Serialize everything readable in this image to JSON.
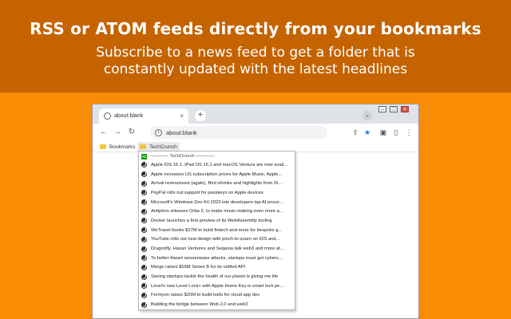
{
  "banner": {
    "title": "RSS or ATOM feeds directly from your bookmarks",
    "subtitle_line1": "Subscribe to a news feed to get a folder that is",
    "subtitle_line2": "constantly updated with the latest headlines"
  },
  "browser": {
    "tab_title": "about:blank",
    "tab_close": "×",
    "new_tab": "+",
    "tab_search": "⌄",
    "window_controls": {
      "minimize": "–",
      "maximize": "□",
      "close": "×"
    },
    "nav": {
      "back": "←",
      "forward": "→",
      "reload": "↻"
    },
    "address": "about:blank",
    "address_info": "i",
    "toolbar_icons": {
      "share": "⇪",
      "star": "★",
      "reading": "▣",
      "profile": "▯",
      "menu": "⋮"
    },
    "bookmarks_bar": [
      {
        "label": "Bookmarks"
      },
      {
        "label": "TechCrunch"
      }
    ]
  },
  "feed_menu": {
    "favicon_text": "TC",
    "header": "———— TechCrunch ————",
    "items": [
      "Apple iOS 16.1, iPad OS 16.1 and macOS Ventura are now avail...",
      "Apple increases US subscription prices for Apple Music, Apple...",
      "Arrival restructures (again), Bird shrinks and highlights from Di...",
      "PayPal rolls out support for passkeys on Apple devices",
      "Microsoft's Windows Dev Kit 2023 lets developers tap AI proce...",
      "Antiphon releases Orba 2, to make music-making even more a...",
      "Docker launches a first preview of its WebAssembly tooling",
      "WeTravel books $27M to build fintech and more for bespoke g...",
      "YouTube rolls out new design with pinch-to-zoom on iOS and...",
      "Dragonfly, Hasun Ventures and Sequoia talk web3 and more at...",
      "To better thwart ransomware attacks, startups must get cybers...",
      "Merge raises $55M Series B for its unified API",
      "Seeing startups tackle the health of our planet is giving me life",
      "Level's new Level Lock+ with Apple Home Key is smart lock pe...",
      "Fermyon raises $20M to build tools for cloud app dev",
      "Building the bridge between Web 2.0 and web3"
    ]
  }
}
